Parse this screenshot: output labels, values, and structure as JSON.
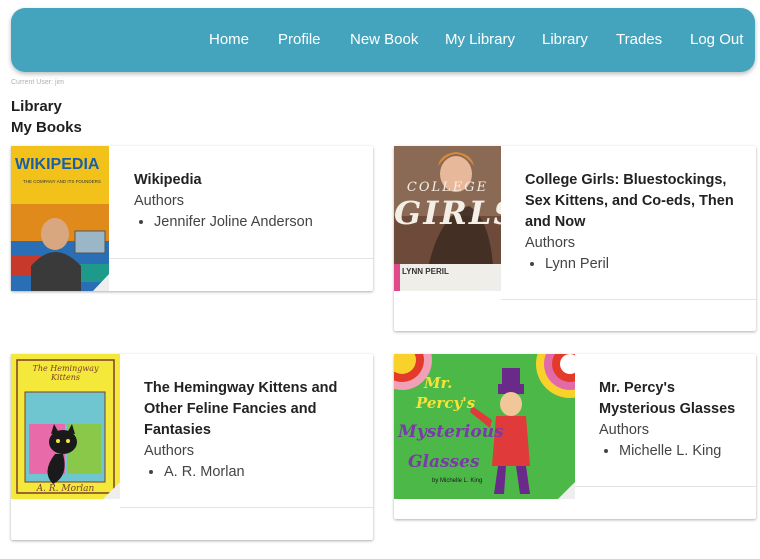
{
  "nav": {
    "items": [
      {
        "label": "Home"
      },
      {
        "label": "Profile"
      },
      {
        "label": "New Book"
      },
      {
        "label": "My Library"
      },
      {
        "label": "Library"
      },
      {
        "label": "Trades"
      },
      {
        "label": "Log Out"
      }
    ]
  },
  "current_user": "Current User: jim",
  "page": {
    "title": "Library",
    "subtitle": "My Books"
  },
  "books": [
    {
      "title": "Wikipedia",
      "authors_label": "Authors",
      "authors": [
        "Jennifer Joline Anderson"
      ],
      "cover_title": "WIKIPEDIA",
      "cover_subtitle": "THE COMPANY AND ITS FOUNDERS"
    },
    {
      "title": "College Girls: Bluestockings, Sex Kittens, and Co-eds, Then and Now",
      "authors_label": "Authors",
      "authors": [
        "Lynn Peril"
      ],
      "cover_title_1": "COLLEGE",
      "cover_title_2": "GIRLS",
      "cover_author": "LYNN PERIL"
    },
    {
      "title": "The Hemingway Kittens and Other Feline Fancies and Fantasies",
      "authors_label": "Authors",
      "authors": [
        "A. R. Morlan"
      ],
      "cover_title": "The Hemingway Kittens",
      "cover_author": "A. R. Morlan"
    },
    {
      "title": "Mr. Percy's Mysterious Glasses",
      "authors_label": "Authors",
      "authors": [
        "Michelle L. King"
      ],
      "cover_title_1": "Mr.",
      "cover_title_2": "Percy's",
      "cover_title_3": "Mysterious",
      "cover_title_4": "Glasses",
      "cover_author": "by Michelle L. King"
    }
  ]
}
